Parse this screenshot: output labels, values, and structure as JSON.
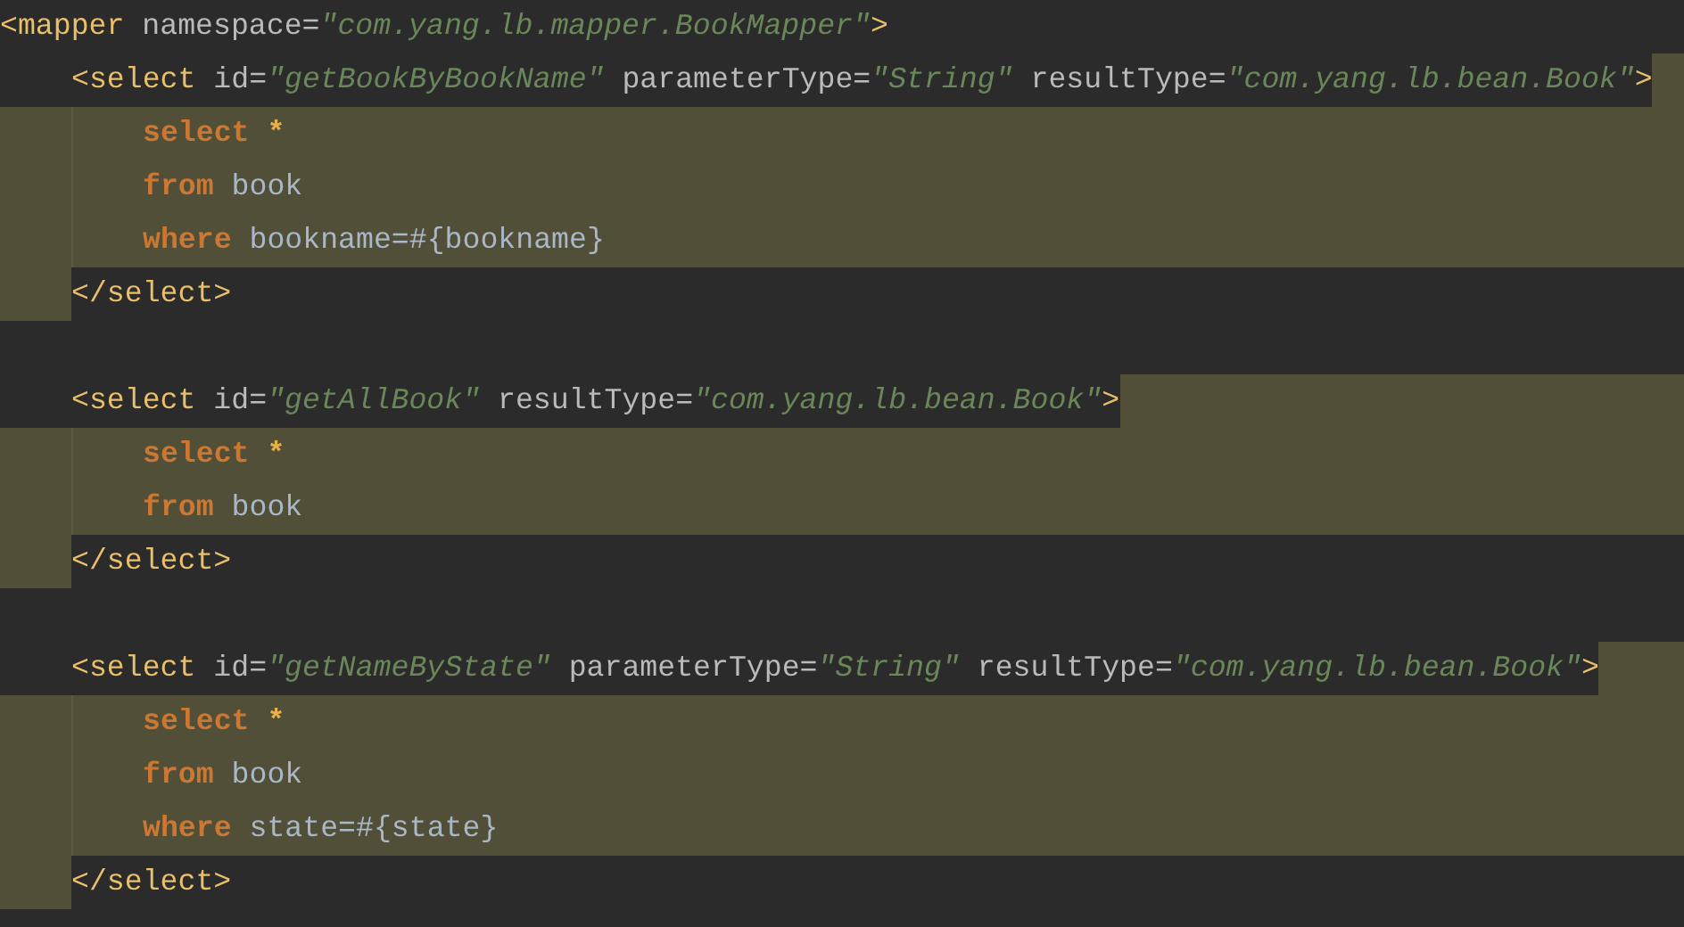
{
  "mapper": {
    "open": [
      {
        "kind": "tag",
        "text": "<mapper"
      },
      {
        "kind": "attr",
        "text": " namespace="
      },
      {
        "kind": "string",
        "text": "\"com.yang.lb.mapper.BookMapper\""
      },
      {
        "kind": "tag",
        "text": ">"
      }
    ],
    "blocks": [
      {
        "highlighted": true,
        "open": [
          {
            "kind": "tag",
            "text": "<select"
          },
          {
            "kind": "attr",
            "text": " id="
          },
          {
            "kind": "string",
            "text": "\"getBookByBookName\""
          },
          {
            "kind": "attr",
            "text": " parameterType="
          },
          {
            "kind": "string",
            "text": "\"String\""
          },
          {
            "kind": "attr",
            "text": " resultType="
          },
          {
            "kind": "string",
            "text": "\"com.yang.lb.bean.Book\""
          },
          {
            "kind": "tag",
            "text": ">"
          }
        ],
        "body": [
          [
            {
              "kind": "keyword",
              "text": "select"
            },
            {
              "kind": "star",
              "text": "*"
            }
          ],
          [
            {
              "kind": "keyword",
              "text": "from"
            },
            {
              "kind": "text",
              "text": " book"
            }
          ],
          [
            {
              "kind": "keyword",
              "text": "where"
            },
            {
              "kind": "text",
              "text": " bookname=#{bookname}"
            }
          ]
        ],
        "close": [
          {
            "kind": "tag",
            "text": "</select>"
          }
        ]
      },
      {
        "highlighted": true,
        "open": [
          {
            "kind": "tag",
            "text": "<select"
          },
          {
            "kind": "attr",
            "text": " id="
          },
          {
            "kind": "string",
            "text": "\"getAllBook\""
          },
          {
            "kind": "attr",
            "text": " resultType="
          },
          {
            "kind": "string",
            "text": "\"com.yang.lb.bean.Book\""
          },
          {
            "kind": "tag",
            "text": ">"
          }
        ],
        "body": [
          [
            {
              "kind": "keyword",
              "text": "select"
            },
            {
              "kind": "star",
              "text": "*"
            }
          ],
          [
            {
              "kind": "keyword",
              "text": "from"
            },
            {
              "kind": "text",
              "text": " book"
            }
          ]
        ],
        "close": [
          {
            "kind": "tag",
            "text": "</select>"
          }
        ]
      },
      {
        "highlighted": true,
        "open": [
          {
            "kind": "tag",
            "text": "<select"
          },
          {
            "kind": "attr",
            "text": " id="
          },
          {
            "kind": "string",
            "text": "\"getNameByState\""
          },
          {
            "kind": "attr",
            "text": " parameterType="
          },
          {
            "kind": "string",
            "text": "\"String\""
          },
          {
            "kind": "attr",
            "text": " resultType="
          },
          {
            "kind": "string",
            "text": "\"com.yang.lb.bean.Book\""
          },
          {
            "kind": "tag",
            "text": ">"
          }
        ],
        "body": [
          [
            {
              "kind": "keyword",
              "text": "select"
            },
            {
              "kind": "star",
              "text": "*"
            }
          ],
          [
            {
              "kind": "keyword",
              "text": "from"
            },
            {
              "kind": "text",
              "text": " book"
            }
          ],
          [
            {
              "kind": "keyword",
              "text": "where"
            },
            {
              "kind": "text",
              "text": " state=#{state}"
            }
          ]
        ],
        "close": [
          {
            "kind": "tag",
            "text": "</select>"
          }
        ]
      }
    ]
  }
}
